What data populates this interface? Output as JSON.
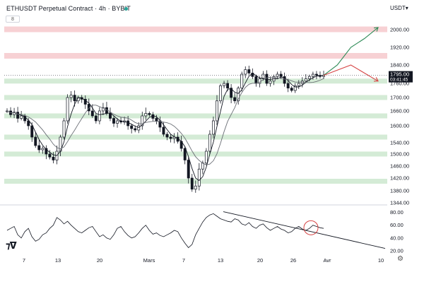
{
  "header": {
    "title": "ETHUSDT Perpetual Contract · 4h · BYBIT",
    "collapse_label": "8",
    "currency_label": "USDT▾"
  },
  "price_badge": {
    "price": "1795.00",
    "countdown": "03:41:45"
  },
  "chart_data": [
    {
      "type": "line",
      "chart": "candlestick",
      "symbol": "ETHUSDT Perpetual Contract",
      "timeframe": "4h",
      "exchange": "BYBIT",
      "currency": "USDT",
      "ylim": [
        1344,
        2060
      ],
      "y_ticks": [
        2000,
        1920,
        1840,
        1760,
        1700,
        1660,
        1600,
        1540,
        1500,
        1460,
        1420,
        1380,
        1344
      ],
      "y_tick_labels": [
        "2000.00",
        "1920.00",
        "1840.00",
        "1760.00",
        "1700.00",
        "1660.00",
        "1600.00",
        "1540.00",
        "1500.00",
        "1460.00",
        "1420.00",
        "1380.00",
        "1344.00"
      ],
      "x_ticks": [
        7,
        13,
        20,
        "Mars",
        7,
        13,
        20,
        26,
        "Avr",
        10
      ],
      "x_tick_labels": [
        "7",
        "13",
        "20",
        "Mars",
        "7",
        "13",
        "20",
        "26",
        "Avr",
        "10"
      ],
      "last_price": 1795,
      "series": [
        {
          "values": [
            1660,
            1645,
            1655,
            1630,
            1640,
            1620,
            1600,
            1560,
            1530,
            1515,
            1520,
            1500,
            1490,
            1480,
            1510,
            1560,
            1620,
            1700,
            1710,
            1690,
            1700,
            1695,
            1680,
            1660,
            1640,
            1620,
            1660,
            1670,
            1650,
            1630,
            1610,
            1620,
            1615,
            1620,
            1600,
            1590,
            1585,
            1600,
            1640,
            1650,
            1645,
            1630,
            1620,
            1595,
            1570,
            1560,
            1555,
            1560,
            1545,
            1520,
            1480,
            1420,
            1385,
            1395,
            1450,
            1470,
            1510,
            1570,
            1620,
            1690,
            1750,
            1760,
            1740,
            1700,
            1690,
            1740,
            1800,
            1820,
            1805,
            1790,
            1760,
            1780,
            1800,
            1760,
            1770,
            1790,
            1800,
            1790,
            1760,
            1740,
            1730,
            1750,
            1760,
            1770,
            1780,
            1790,
            1800,
            1795,
            1790,
            1795
          ]
        }
      ],
      "support_zones": [
        1770,
        1700,
        1640,
        1560,
        1500,
        1410
      ],
      "resistance_zones": [
        2000,
        1880
      ],
      "projections": {
        "bullish": [
          1795,
          1840,
          1920,
          1960,
          2010
        ],
        "bearish": [
          1795,
          1840,
          1770
        ]
      }
    },
    {
      "type": "line",
      "chart": "oscillator",
      "ylim": [
        20,
        85
      ],
      "y_ticks": [
        80,
        60,
        40,
        20
      ],
      "y_tick_labels": [
        "80.00",
        "60.00",
        "40.00",
        "20.00"
      ],
      "series": [
        {
          "values": [
            52,
            55,
            58,
            45,
            40,
            50,
            55,
            42,
            35,
            38,
            45,
            48,
            55,
            60,
            72,
            68,
            62,
            66,
            60,
            55,
            50,
            48,
            52,
            56,
            58,
            50,
            42,
            45,
            40,
            38,
            45,
            55,
            58,
            50,
            44,
            40,
            42,
            48,
            55,
            60,
            52,
            46,
            48,
            44,
            42,
            45,
            48,
            52,
            50,
            40,
            32,
            25,
            30,
            45,
            55,
            65,
            72,
            76,
            78,
            74,
            70,
            68,
            66,
            65,
            70,
            68,
            62,
            60,
            64,
            58,
            55,
            60,
            62,
            56,
            52,
            55,
            58,
            54,
            52,
            48,
            50,
            55,
            58,
            54,
            52,
            55,
            60,
            58,
            56,
            55
          ]
        }
      ],
      "trendline": [
        80,
        26
      ],
      "highlight_value": 56
    }
  ]
}
